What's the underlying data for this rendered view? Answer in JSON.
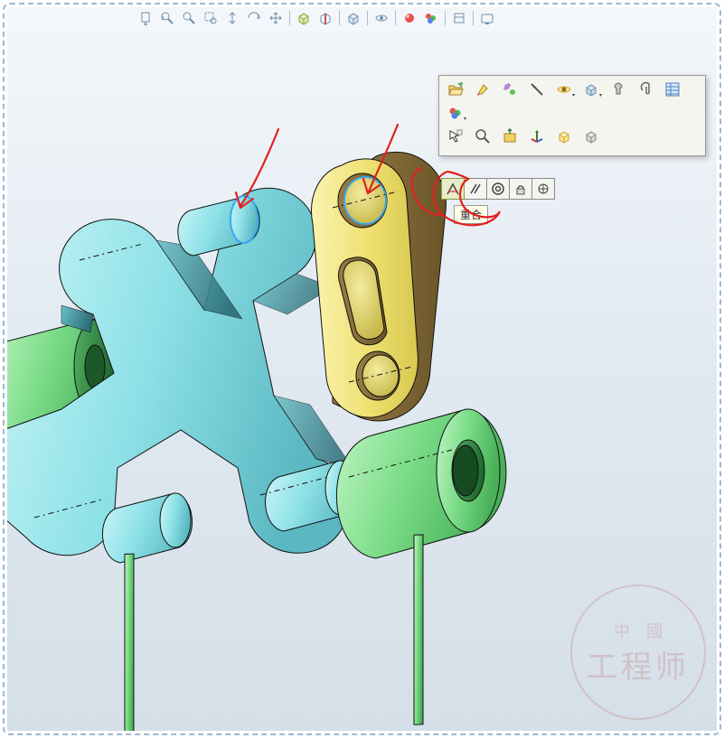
{
  "hud": {
    "items": [
      {
        "name": "front-view-icon"
      },
      {
        "name": "previous-view-icon"
      },
      {
        "name": "zoom-fit-icon"
      },
      {
        "name": "zoom-area-icon"
      },
      {
        "name": "zoom-dynamic-icon"
      },
      {
        "name": "rotate-icon"
      },
      {
        "name": "pan-icon"
      },
      {
        "sep": true
      },
      {
        "name": "display-style-icon"
      },
      {
        "name": "section-view-icon"
      },
      {
        "sep": true
      },
      {
        "name": "perspective-icon"
      },
      {
        "sep": true
      },
      {
        "name": "hide-show-icon"
      },
      {
        "sep": true
      },
      {
        "name": "scene-edit-icon"
      },
      {
        "name": "appearance-icon"
      },
      {
        "sep": true
      },
      {
        "name": "view-settings-icon"
      },
      {
        "sep": true
      },
      {
        "name": "screen-capture-icon"
      }
    ]
  },
  "context_panel": {
    "row1": [
      {
        "name": "open-part-icon"
      },
      {
        "name": "highlight-icon"
      },
      {
        "name": "measure-icon"
      },
      {
        "name": "select-other-icon"
      },
      {
        "name": "show-hidden-icon"
      },
      {
        "name": "change-transparency-icon"
      },
      {
        "name": "fixed-icon"
      },
      {
        "name": "attachment-icon"
      },
      {
        "name": "properties-icon"
      }
    ],
    "row2": [
      {
        "name": "appearances-icon"
      }
    ],
    "row3": [
      {
        "name": "select-component-icon"
      },
      {
        "name": "zoom-to-selection-icon"
      },
      {
        "name": "normal-to-icon"
      },
      {
        "name": "move-triad-icon"
      },
      {
        "name": "show-icon"
      },
      {
        "name": "isolate-icon"
      }
    ]
  },
  "mate_toolbar": {
    "buttons": [
      {
        "name": "coincident-mate-icon",
        "selected": true
      },
      {
        "name": "parallel-mate-icon"
      },
      {
        "name": "concentric-mate-icon"
      },
      {
        "name": "lock-mate-icon"
      },
      {
        "name": "distance-mate-icon"
      }
    ],
    "tooltip": "重合"
  },
  "watermark": {
    "top": "中國",
    "main": "工程师"
  },
  "colors": {
    "cyan": "#9be4ea",
    "cyan_dark": "#3b7d86",
    "yellow": "#f2e78b",
    "yellow_dark": "#8a7a2f",
    "green": "#8de29a",
    "green_dark": "#2f7a3c",
    "red_annot": "#e12020"
  }
}
